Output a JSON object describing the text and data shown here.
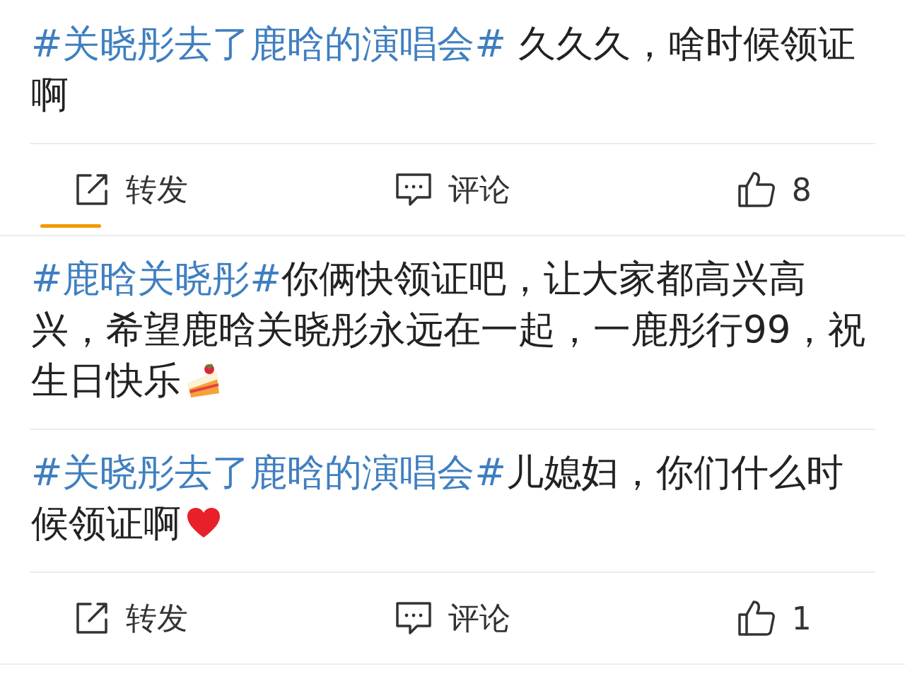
{
  "posts": [
    {
      "segments": [
        {
          "kind": "hashtag",
          "text": "#关晓彤去了鹿晗的演唱会#"
        },
        {
          "kind": "text",
          "text": " 久久久，啥时候领证啊"
        }
      ],
      "actions": [
        {
          "kind": "repost",
          "label": "转发",
          "selected": true
        },
        {
          "kind": "comment",
          "label": "评论",
          "selected": false
        },
        {
          "kind": "like",
          "label": "8",
          "selected": false
        }
      ]
    },
    {
      "segments": [
        {
          "kind": "hashtag",
          "text": "#鹿晗关晓彤#"
        },
        {
          "kind": "text",
          "text": "你俩快领证吧，让大家都高兴高兴，希望鹿晗关晓彤永远在一起，一鹿彤行99，祝生日快乐"
        },
        {
          "kind": "cake"
        }
      ]
    },
    {
      "segments": [
        {
          "kind": "hashtag",
          "text": "#关晓彤去了鹿晗的演唱会#"
        },
        {
          "kind": "text",
          "text": "儿媳妇，你们什么时候领证啊"
        },
        {
          "kind": "heart"
        }
      ],
      "actions": [
        {
          "kind": "repost",
          "label": "转发",
          "selected": false
        },
        {
          "kind": "comment",
          "label": "评论",
          "selected": false
        },
        {
          "kind": "like",
          "label": "1",
          "selected": false
        }
      ]
    }
  ]
}
